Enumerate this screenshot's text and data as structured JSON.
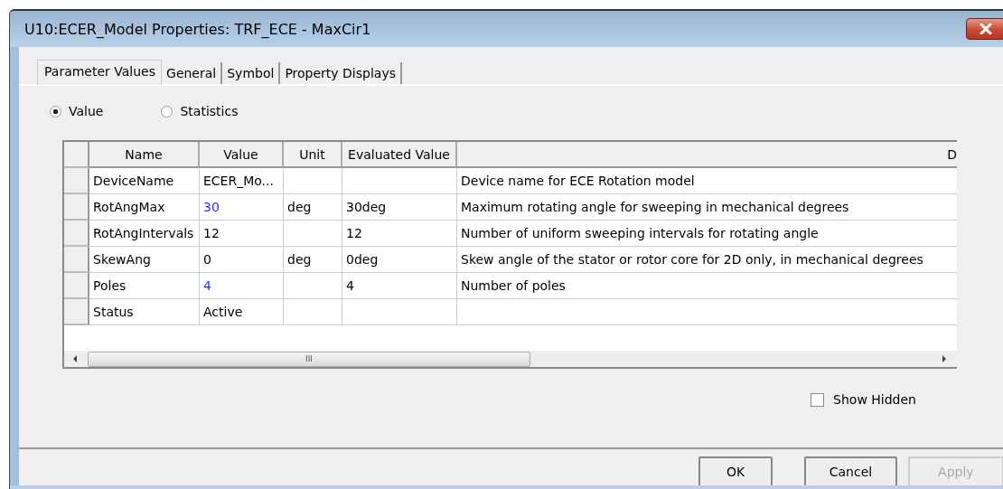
{
  "window": {
    "title": "U10:ECER_Model Properties: TRF_ECE - MaxCir1"
  },
  "tabs": [
    {
      "label": "Parameter Values",
      "selected": true
    },
    {
      "label": "General",
      "selected": false
    },
    {
      "label": "Symbol",
      "selected": false
    },
    {
      "label": "Property Displays",
      "selected": false
    }
  ],
  "view_options": [
    {
      "label": "Value",
      "selected": true
    },
    {
      "label": "Statistics",
      "selected": false
    }
  ],
  "table": {
    "columns": [
      "Name",
      "Value",
      "Unit",
      "Evaluated Value",
      "D"
    ],
    "rows": [
      {
        "name": "DeviceName",
        "value": "ECER_Mo...",
        "unit": "",
        "evaluated": "",
        "description": "Device name for ECE Rotation model",
        "color": "#000000"
      },
      {
        "name": "RotAngMax",
        "value": "30",
        "unit": "deg",
        "evaluated": "30deg",
        "description": "Maximum rotating angle for sweeping in mechanical degrees",
        "color": "#2b2bff"
      },
      {
        "name": "RotAngIntervals",
        "value": "12",
        "unit": "",
        "evaluated": "12",
        "description": "Number of uniform sweeping intervals for rotating angle",
        "color": "#000000"
      },
      {
        "name": "SkewAng",
        "value": "0",
        "unit": "deg",
        "evaluated": "0deg",
        "description": "Skew angle of the stator or rotor core for 2D only, in mechanical degrees",
        "color": "#000000"
      },
      {
        "name": "Poles",
        "value": "4",
        "unit": "",
        "evaluated": "4",
        "description": "Number of poles",
        "color": "#2b2bff"
      },
      {
        "name": "Status",
        "value": "Active",
        "unit": "",
        "evaluated": "",
        "description": "",
        "color": "#000000"
      }
    ],
    "scrollbar_grip": "III"
  },
  "show_hidden": {
    "label": "Show Hidden",
    "checked": false
  },
  "buttons": [
    {
      "label": "OK",
      "disabled": false
    },
    {
      "label": "Cancel",
      "disabled": false
    },
    {
      "label": "Apply",
      "disabled": true
    }
  ]
}
